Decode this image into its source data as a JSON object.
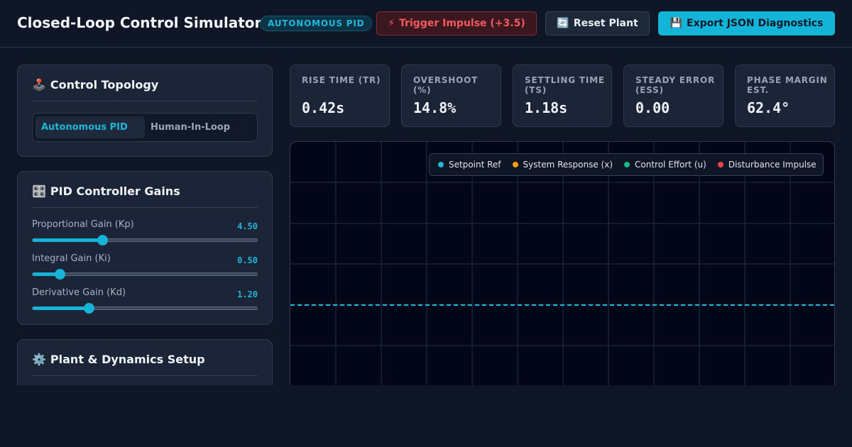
{
  "header": {
    "title": "Closed-Loop Control Simulator",
    "mode_badge": "AUTONOMOUS PID",
    "impulse_button": "Trigger Impulse (+3.5)",
    "reset_button": "Reset Plant",
    "export_button": "Export JSON Diagnostics",
    "impulse_icon": "lightning-icon",
    "reset_icon": "refresh-icon",
    "export_icon": "floppy-disk-icon"
  },
  "topology": {
    "title": "Control Topology",
    "icon": "joystick-icon",
    "options": [
      "Autonomous PID",
      "Human-In-Loop"
    ],
    "selected": "Autonomous PID"
  },
  "gains": {
    "title": "PID Controller Gains",
    "icon": "control-knobs-icon",
    "kp": {
      "label": "Proportional Gain (Kp)",
      "value": "4.50",
      "fraction": 0.31
    },
    "ki": {
      "label": "Integral Gain (Ki)",
      "value": "0.50",
      "fraction": 0.12
    },
    "kd": {
      "label": "Derivative Gain (Kd)",
      "value": "1.20",
      "fraction": 0.25
    }
  },
  "plant": {
    "title": "Plant & Dynamics Setup",
    "icon": "gear-icon"
  },
  "metrics": [
    {
      "label": "RISE TIME (TR)",
      "value": "0.42s"
    },
    {
      "label": "OVERSHOOT (%)",
      "value": "14.8%"
    },
    {
      "label": "SETTLING TIME (TS)",
      "value": "1.18s"
    },
    {
      "label": "STEADY ERROR (ESS)",
      "value": "0.00"
    },
    {
      "label": "PHASE MARGIN EST.",
      "value": "62.4°"
    }
  ],
  "legend": [
    {
      "label": "Setpoint Ref",
      "color": "#1fb6d8"
    },
    {
      "label": "System Response (x)",
      "color": "#f59e0b"
    },
    {
      "label": "Control Effort (u)",
      "color": "#10b981"
    },
    {
      "label": "Disturbance Impulse",
      "color": "#ef4444"
    }
  ],
  "colors": {
    "accent": "#12b5d8",
    "danger": "#f25a5e",
    "background": "#0f1626",
    "panel": "#1c2537"
  }
}
